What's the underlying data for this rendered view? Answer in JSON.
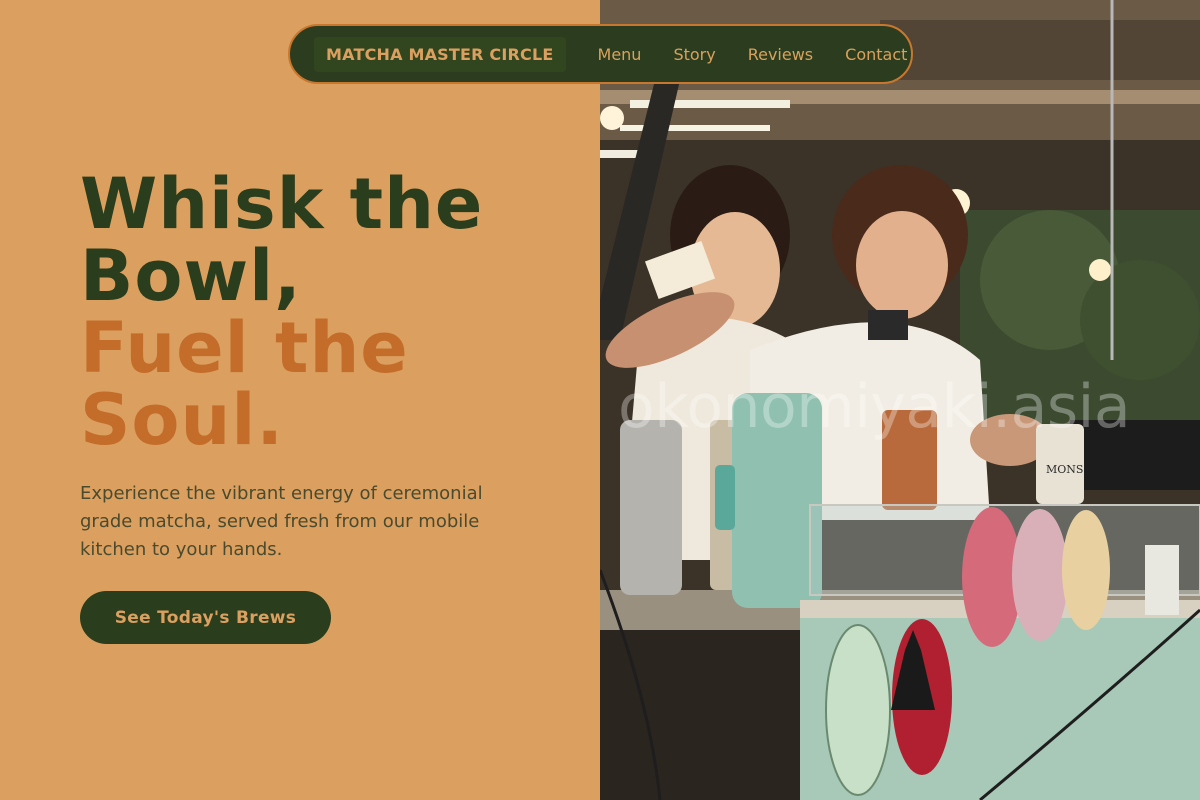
{
  "nav": {
    "brand": "MATCHA MASTER CIRCLE",
    "links": [
      "Menu",
      "Story",
      "Reviews",
      "Contact"
    ]
  },
  "hero": {
    "title_line1": "Whisk the",
    "title_line2": "Bowl,",
    "title_line3": "Fuel the",
    "title_line4": "Soul.",
    "description": "Experience the vibrant energy of ceremonial grade matcha, served fresh from our mobile kitchen to your hands.",
    "cta_label": "See Today's Brews"
  },
  "photo": {
    "watermark": "okonomiyaki.asia",
    "sign_text": "MONS"
  },
  "colors": {
    "background": "#dba060",
    "dark_green": "#2a3d1d",
    "accent_orange": "#c46d2a",
    "nav_border": "#c9772e"
  }
}
